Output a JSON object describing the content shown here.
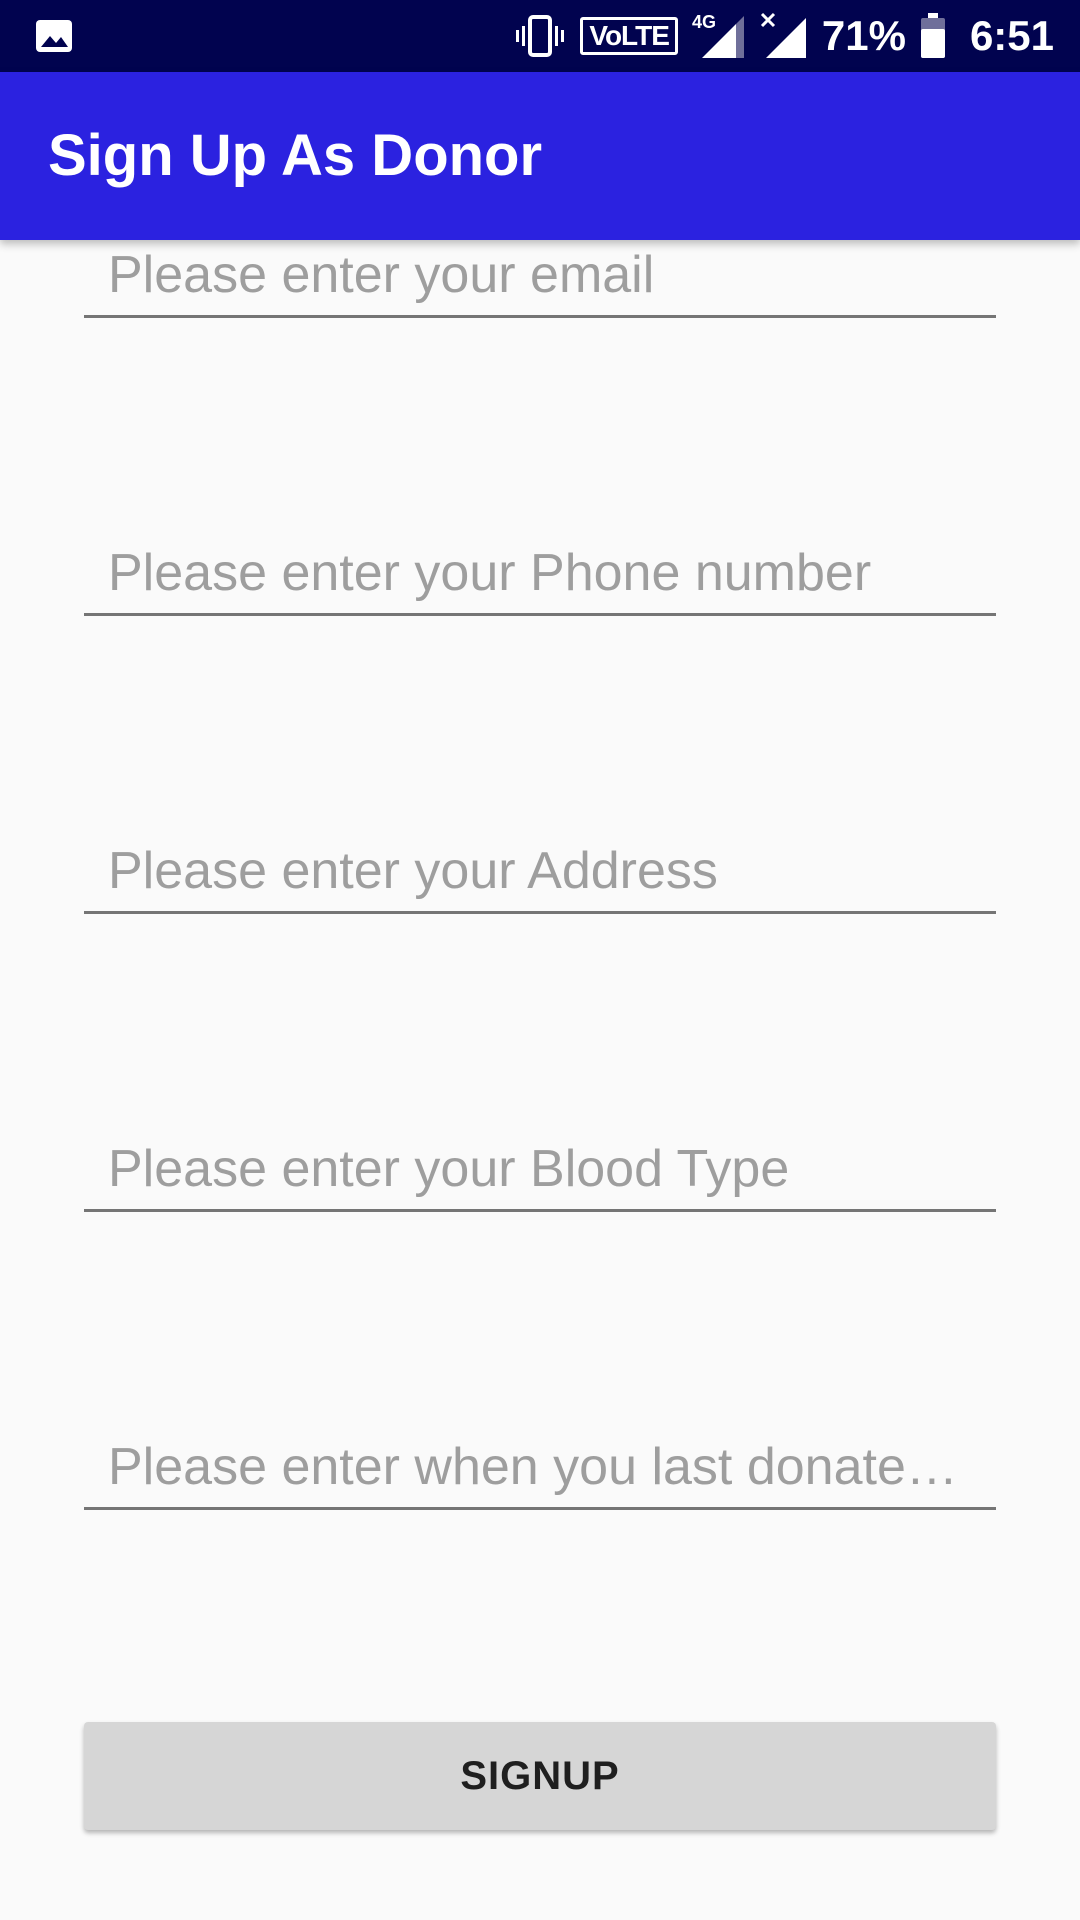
{
  "status_bar": {
    "left_icon": "image-icon",
    "icons": [
      "vibrate-icon",
      "volte-icon",
      "signal-4g-icon",
      "signal-no-data-icon",
      "battery-icon"
    ],
    "volte_label": "VoLTE",
    "network_label": "4G",
    "battery_percent": "71%",
    "time": "6:51"
  },
  "app_bar": {
    "title": "Sign Up As Donor",
    "color": "#2b22e0"
  },
  "form": {
    "email": {
      "placeholder": "Please enter your email",
      "value": ""
    },
    "phone": {
      "placeholder": "Please enter your Phone number",
      "value": ""
    },
    "address": {
      "placeholder": "Please enter your Address",
      "value": ""
    },
    "blood_type": {
      "placeholder": "Please enter your Blood Type",
      "value": ""
    },
    "last_donated": {
      "placeholder": "Please enter when you last donate…",
      "value": ""
    }
  },
  "signup_button": {
    "label": "SIGNUP"
  }
}
